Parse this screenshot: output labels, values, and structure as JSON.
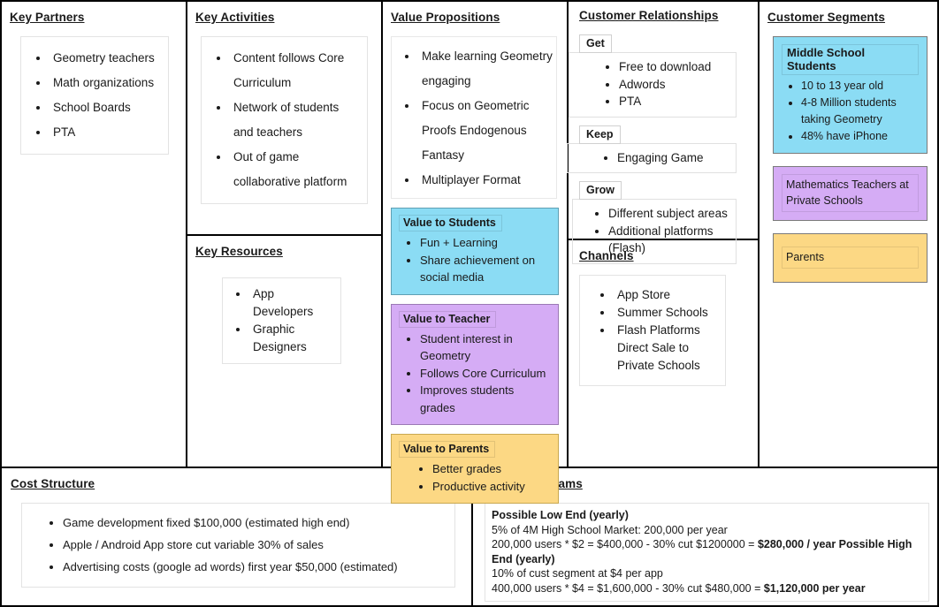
{
  "canvas": {
    "blocks": {
      "key_partners": {
        "title": "Key Partners",
        "items": [
          "Geometry teachers",
          "Math organizations",
          "School Boards",
          "PTA"
        ]
      },
      "key_activities": {
        "title": "Key Activities",
        "items": [
          "Content follows Core Curriculum",
          "Network of students and teachers",
          "Out of game collaborative platform"
        ]
      },
      "key_resources": {
        "title": "Key Resources",
        "items": [
          "App Developers",
          "Graphic Designers"
        ]
      },
      "value_propositions": {
        "title": "Value Propositions",
        "items": [
          "Make learning Geometry engaging",
          "Focus on Geometric Proofs Endogenous Fantasy",
          "Multiplayer Format"
        ],
        "cards": [
          {
            "title": "Value to Students",
            "color": "#8BDCF4",
            "items": [
              "Fun + Learning",
              "Share achievement on social media"
            ]
          },
          {
            "title": "Value to Teacher",
            "color": "#D5ACF5",
            "items": [
              "Student interest in Geometry",
              "Follows Core Curriculum",
              "Improves students grades"
            ]
          },
          {
            "title": "Value to Parents",
            "color": "#FCD884",
            "items": [
              "Better grades",
              "Productive activity"
            ]
          }
        ]
      },
      "customer_relationships": {
        "title": "Customer Relationships",
        "groups": [
          {
            "label": "Get",
            "items": [
              "Free to download",
              "Adwords",
              "PTA"
            ]
          },
          {
            "label": "Keep",
            "items": [
              "Engaging Game"
            ]
          },
          {
            "label": "Grow",
            "items": [
              "Different subject areas",
              "Additional platforms (Flash)"
            ]
          }
        ]
      },
      "channels": {
        "title": "Channels",
        "items": [
          "App Store",
          "Summer Schools",
          "Flash Platforms"
        ],
        "continuation": "Direct Sale to Private Schools"
      },
      "customer_segments": {
        "title": "Customer Segments",
        "cards": [
          {
            "title": "Middle School Students",
            "color": "#8BDCF4",
            "items": [
              "10 to 13 year old",
              "4-8 Million students taking Geometry",
              "48% have iPhone"
            ]
          },
          {
            "title": "",
            "color": "#D5ACF5",
            "text": "Mathematics Teachers at Private Schools"
          },
          {
            "title": "",
            "color": "#FCD884",
            "text": "Parents"
          }
        ]
      },
      "cost_structure": {
        "title": "Cost Structure",
        "items": [
          "Game development fixed $100,000 (estimated high end)",
          "Apple / Android App store cut variable 30% of sales",
          "Advertising costs (google ad words)  first year $50,000 (estimated)"
        ]
      },
      "revenue_streams": {
        "title": "Revenue Streams",
        "lines": [
          {
            "text": "Possible Low End (yearly)",
            "bold": true
          },
          {
            "text": "5% of 4M High School Market:  200,000 per year",
            "bold": false
          },
          {
            "prefix": "200,000 users * $2 = $400,000 - 30% cut $1200000 = ",
            "strong": "$280,000 / year Possible High End (yearly)",
            "bold": false
          },
          {
            "text": "10% of cust segment at $4 per app",
            "bold": false
          },
          {
            "prefix": "400,000 users * $4 = $1,600,000 - 30% cut $480,000 = ",
            "strong": "$1,120,000 per year",
            "bold": false
          }
        ]
      }
    }
  }
}
